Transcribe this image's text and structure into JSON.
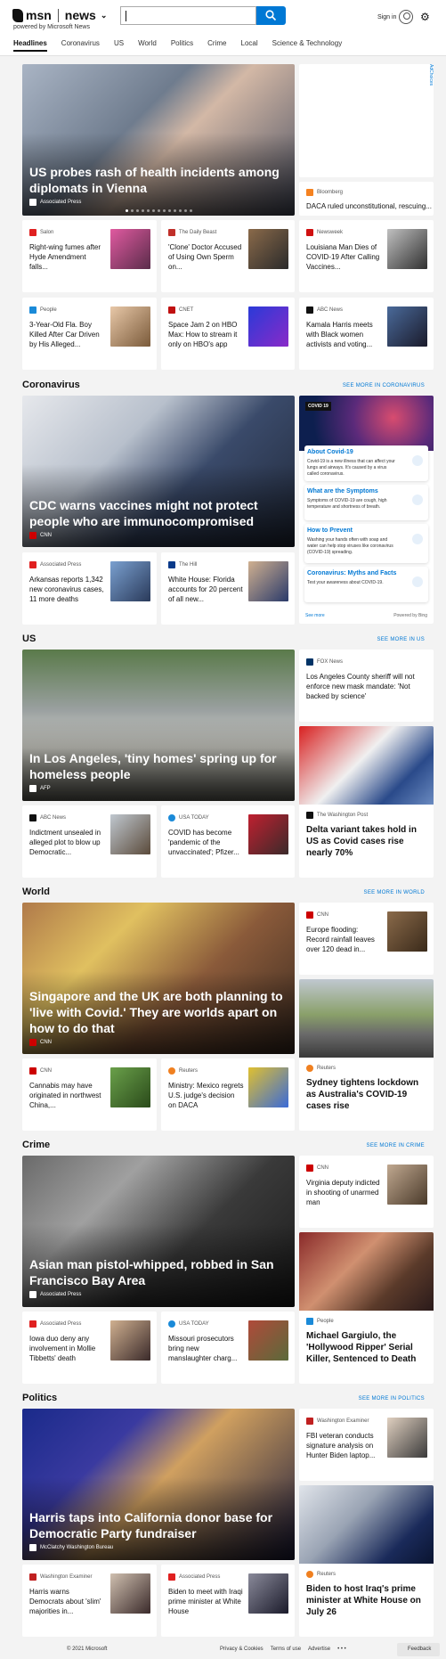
{
  "header": {
    "brand": "msn",
    "product": "news",
    "powered": "powered by Microsoft News",
    "search_placeholder": "",
    "signin": "Sign in"
  },
  "nav": [
    "Headlines",
    "Coronavirus",
    "US",
    "World",
    "Politics",
    "Crime",
    "Local",
    "Science & Technology"
  ],
  "ad_label": "AdChoices",
  "headlines": {
    "hero": {
      "title": "US probes rash of health incidents among diplomats in Vienna",
      "source": "Associated Press"
    },
    "side": {
      "source": "Bloomberg",
      "title": "DACA ruled unconstitutional, rescuing..."
    },
    "cards": [
      {
        "source": "Salon",
        "title": "Right-wing fumes after Hyde Amendment falls..."
      },
      {
        "source": "The Daily Beast",
        "title": "'Clone' Doctor Accused of Using Own Sperm on..."
      },
      {
        "source": "Newsweek",
        "title": "Louisiana Man Dies of COVID-19 After Calling Vaccines..."
      },
      {
        "source": "People",
        "title": "3-Year-Old Fla. Boy Killed After Car Driven by His Alleged..."
      },
      {
        "source": "CNET",
        "title": "Space Jam 2 on HBO Max: How to stream it only on HBO's app"
      },
      {
        "source": "ABC News",
        "title": "Kamala Harris meets with Black women activists and voting..."
      }
    ]
  },
  "coronavirus": {
    "heading": "Coronavirus",
    "see_more": "SEE MORE IN CORONAVIRUS",
    "hero": {
      "title": "CDC warns vaccines might not protect people who are immunocompromised",
      "source": "CNN"
    },
    "cards": [
      {
        "source": "Associated Press",
        "title": "Arkansas reports 1,342 new coronavirus cases, 11 more deaths"
      },
      {
        "source": "The Hill",
        "title": "White House: Florida accounts for 20 percent of all new..."
      }
    ],
    "panel": {
      "tag": "COVID 19",
      "items": [
        {
          "h": "About Covid-19",
          "d": "Covid-19 is a new illness that can affect your lungs and airways. It's caused by a virus called coronavirus."
        },
        {
          "h": "What are the Symptoms",
          "d": "Symptoms of COVID-19 are cough, high temperature and shortness of breath."
        },
        {
          "h": "How to Prevent",
          "d": "Washing your hands often with soap and water can help stop viruses like coronavirus (COVID-19) spreading."
        },
        {
          "h": "Coronavirus: Myths and Facts",
          "d": "Test your awareness about COVID-19."
        }
      ],
      "see_more": "See more",
      "powered": "Powered by Bing"
    }
  },
  "us": {
    "heading": "US",
    "see_more": "SEE MORE IN US",
    "hero": {
      "title": "In Los Angeles, 'tiny homes' spring up for homeless people",
      "source": "AFP"
    },
    "side1": {
      "source": "FOX News",
      "title": "Los Angeles County sheriff will not enforce new mask mandate: 'Not backed by science'"
    },
    "side2": {
      "source": "The Washington Post",
      "title": "Delta variant takes hold in US as Covid cases rise nearly 70%"
    },
    "cards": [
      {
        "source": "ABC News",
        "title": "Indictment unsealed in alleged plot to blow up Democratic..."
      },
      {
        "source": "USA TODAY",
        "title": "COVID has become 'pandemic of the unvaccinated'; Pfizer..."
      }
    ]
  },
  "world": {
    "heading": "World",
    "see_more": "SEE MORE IN WORLD",
    "hero": {
      "title": "Singapore and the UK are both planning to 'live with Covid.' They are worlds apart on how to do that",
      "source": "CNN"
    },
    "side1": {
      "source": "CNN",
      "title": "Europe flooding: Record rainfall leaves over 120 dead in..."
    },
    "side2": {
      "source": "Reuters",
      "title": "Sydney tightens lockdown as Australia's COVID-19 cases rise"
    },
    "cards": [
      {
        "source": "CNN",
        "title": "Cannabis may have originated in northwest China,..."
      },
      {
        "source": "Reuters",
        "title": "Ministry: Mexico regrets U.S. judge's decision on DACA"
      }
    ]
  },
  "crime": {
    "heading": "Crime",
    "see_more": "SEE MORE IN CRIME",
    "hero": {
      "title": "Asian man pistol-whipped, robbed in San Francisco Bay Area",
      "source": "Associated Press"
    },
    "side1": {
      "source": "CNN",
      "title": "Virginia deputy indicted in shooting of unarmed man"
    },
    "side2": {
      "source": "People",
      "title": "Michael Gargiulo, the 'Hollywood Ripper' Serial Killer, Sentenced to Death"
    },
    "cards": [
      {
        "source": "Associated Press",
        "title": "Iowa duo deny any involvement in Mollie Tibbetts' death"
      },
      {
        "source": "USA TODAY",
        "title": "Missouri prosecutors bring new manslaughter charg..."
      }
    ]
  },
  "politics": {
    "heading": "Politics",
    "see_more": "SEE MORE IN POLITICS",
    "hero": {
      "title": "Harris taps into California donor base for Democratic Party fundraiser",
      "source": "McClatchy Washington Bureau"
    },
    "side1": {
      "source": "Washington Examiner",
      "title": "FBI veteran conducts signature analysis on Hunter Biden laptop..."
    },
    "side2": {
      "source": "Reuters",
      "title": "Biden to host Iraq's prime minister at White House on July 26"
    },
    "cards": [
      {
        "source": "Washington Examiner",
        "title": "Harris warns Democrats about 'slim' majorities in..."
      },
      {
        "source": "Associated Press",
        "title": "Biden to meet with Iraqi prime minister at White House"
      }
    ]
  },
  "footer": {
    "copyright": "© 2021 Microsoft",
    "links": [
      "Privacy & Cookies",
      "Terms of use",
      "Advertise",
      "• • •"
    ],
    "feedback": "Feedback"
  },
  "colors": {
    "accent": "#0078d4",
    "bg": "#f3f3f3",
    "card": "#ffffff"
  }
}
